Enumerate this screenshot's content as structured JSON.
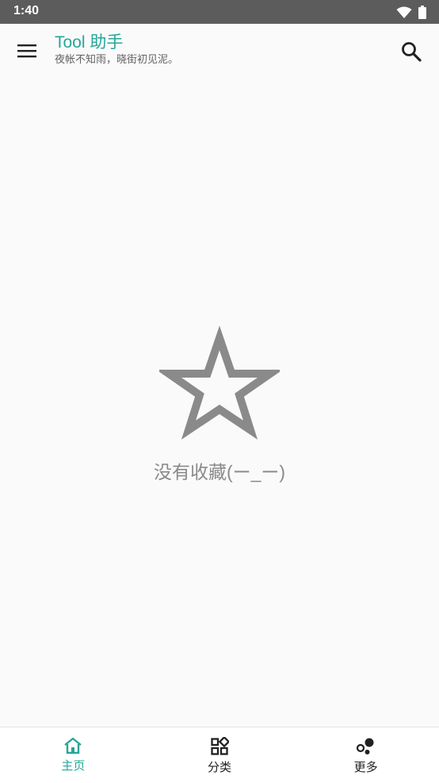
{
  "status_bar": {
    "time": "1:40",
    "icons": [
      "wifi-icon",
      "battery-icon"
    ]
  },
  "app_bar": {
    "title": "Tool 助手",
    "subtitle": "夜帐不知雨，晓街初见泥。",
    "left_icon": "menu-icon",
    "right_icon": "search-icon"
  },
  "empty_state": {
    "icon": "star-outline-icon",
    "message": "没有收藏(ー_ー)"
  },
  "bottom_nav": {
    "items": [
      {
        "label": "主页",
        "icon": "home-icon",
        "active": true
      },
      {
        "label": "分类",
        "icon": "category-icon",
        "active": false
      },
      {
        "label": "更多",
        "icon": "more-bubbles-icon",
        "active": false
      }
    ]
  },
  "colors": {
    "accent": "#26a69a",
    "status_bar": "#5c5c5c",
    "background": "#fafafa",
    "empty_icon": "#8a8a8a"
  }
}
